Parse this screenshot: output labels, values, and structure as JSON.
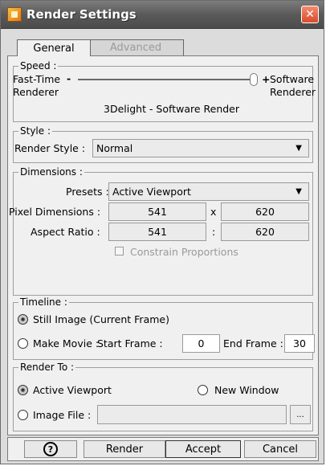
{
  "window": {
    "title": "Render Settings",
    "close_glyph": "✕"
  },
  "tabs": [
    {
      "label": "General",
      "active": true
    },
    {
      "label": "Advanced",
      "active": false
    }
  ],
  "speed": {
    "legend": "Speed :",
    "left_label_line1": "Fast-Time",
    "left_label_line2": "Renderer",
    "minus": "-",
    "plus": "+",
    "right_label_line1": "Software",
    "right_label_line2": "Renderer",
    "current": "3Delight - Software Render",
    "slider_value_fraction": 1.0
  },
  "style": {
    "legend": "Style :",
    "label": "Render Style :",
    "value": "Normal"
  },
  "dimensions": {
    "legend": "Dimensions :",
    "presets_label": "Presets :",
    "presets_value": "Active Viewport",
    "pixel_label": "Pixel Dimensions :",
    "pixel_w": "541",
    "pixel_sep": "x",
    "pixel_h": "620",
    "aspect_label": "Aspect Ratio :",
    "aspect_w": "541",
    "aspect_sep": ":",
    "aspect_h": "620",
    "constrain_label": "Constrain Proportions"
  },
  "timeline": {
    "legend": "Timeline :",
    "still_label": "Still Image (Current Frame)",
    "movie_label": "Make Movie :",
    "start_label": "Start Frame :",
    "start_value": "0",
    "end_label": "End Frame :",
    "end_value": "30"
  },
  "render_to": {
    "legend": "Render To :",
    "viewport_label": "Active Viewport",
    "new_window_label": "New Window",
    "image_file_label": "Image File :",
    "image_file_value": "",
    "browse_label": "..."
  },
  "buttons": {
    "help_glyph": "?",
    "render": "Render",
    "accept": "Accept",
    "cancel": "Cancel"
  },
  "colors": {
    "titlebar": "#5a5a5a",
    "panel": "#f0f0f0",
    "close": "#d94a2b"
  }
}
